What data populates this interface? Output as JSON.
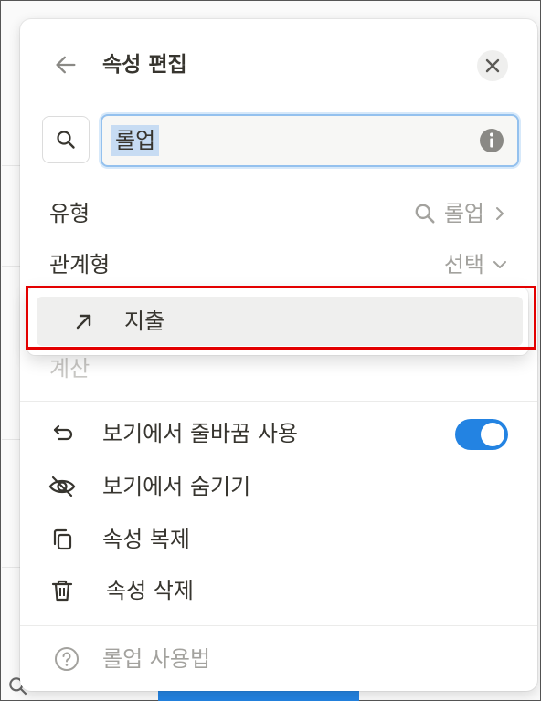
{
  "panel": {
    "title": "속성 편집",
    "name_value": "롤업"
  },
  "properties": {
    "type_label": "유형",
    "type_value": "롤업",
    "relation_label": "관계형",
    "relation_value": "선택",
    "calc_label": "계산"
  },
  "dropdown": {
    "options": [
      {
        "label": "지출"
      }
    ]
  },
  "menu": {
    "wrap": "보기에서 줄바꿈 사용",
    "wrap_toggle_on": true,
    "hide": "보기에서 숨기기",
    "duplicate": "속성 복제",
    "delete": "속성 삭제",
    "help": "롤업 사용법"
  },
  "colors": {
    "accent": "#2383e2",
    "highlight_box": "#e30000",
    "muted_text": "#a3a29e"
  }
}
